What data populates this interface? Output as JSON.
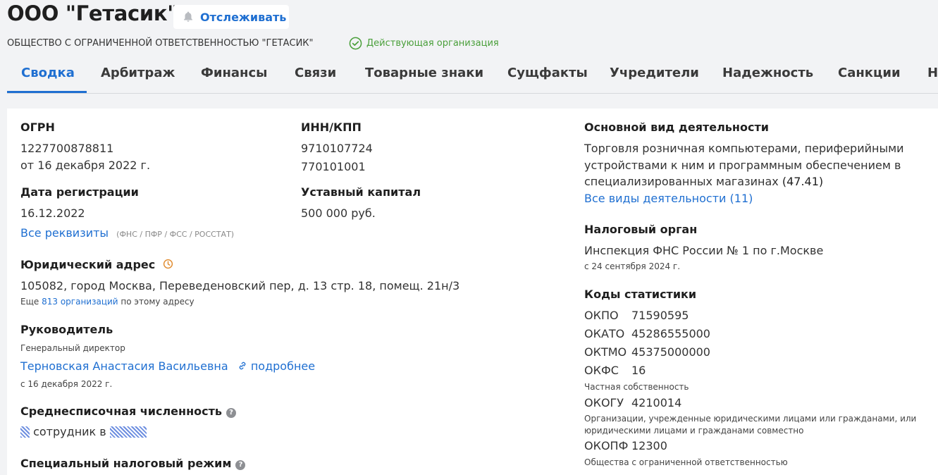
{
  "company": {
    "short_name": "ООО \"Гетасик\"",
    "full_name": "ОБЩЕСТВО С ОГРАНИЧЕННОЙ ОТВЕТСТВЕННОСТЬЮ \"ГЕТАСИК\"",
    "status": "Действующая организация",
    "follow_label": "Отслеживать"
  },
  "tabs": [
    "Сводка",
    "Арбитраж",
    "Финансы",
    "Связи",
    "Товарные знаки",
    "Сущфакты",
    "Учредители",
    "Надежность",
    "Санкции",
    "Н"
  ],
  "ogrn": {
    "label": "ОГРН",
    "value": "1227700878811",
    "date": "от 16 декабря 2022 г."
  },
  "inn": {
    "label": "ИНН/КПП",
    "inn": "9710107724",
    "kpp": "770101001"
  },
  "reg": {
    "label": "Дата регистрации",
    "value": "16.12.2022"
  },
  "capital": {
    "label": "Уставный капитал",
    "value": "500 000 руб."
  },
  "requisites": {
    "link": "Все реквизиты",
    "note": "(ФНС / ПФР / ФСС / РОССТАТ)"
  },
  "address": {
    "label": "Юридический адрес",
    "value": "105082, город Москва, Переведеновский пер, д. 13 стр. 18, помещ. 21н/3",
    "more_prefix": "Еще",
    "more_link": "813 организаций",
    "more_suffix": "по этому адресу"
  },
  "head": {
    "label": "Руководитель",
    "position": "Генеральный директор",
    "name": "Терновская Анастасия Васильевна",
    "more": "подробнее",
    "since": "с 16 декабря 2022 г."
  },
  "employees": {
    "label": "Среднесписочная численность",
    "text": "сотрудник в"
  },
  "tax_regime": {
    "label": "Специальный налоговый режим"
  },
  "activity": {
    "label": "Основной вид деятельности",
    "line1": "Торговля розничная компьютерами, периферийными",
    "line2": "устройствами к ним и программным обеспечением в",
    "line3": "специализированных магазинах",
    "code": "(47.41)",
    "all_link": "Все виды деятельности (11)"
  },
  "tax_office": {
    "label": "Налоговый орган",
    "value": "Инспекция ФНС России № 1 по г.Москве",
    "since": "с 24 сентября 2024 г."
  },
  "stat_codes": {
    "label": "Коды статистики",
    "okpo": {
      "code": "ОКПО",
      "value": "71590595"
    },
    "okato": {
      "code": "ОКАТО",
      "value": "45286555000"
    },
    "oktmo": {
      "code": "ОКТМО",
      "value": "45375000000"
    },
    "okfs": {
      "code": "ОКФС",
      "value": "16",
      "desc": "Частная собственность"
    },
    "okogu": {
      "code": "ОКОГУ",
      "value": "4210014",
      "desc1": "Организации, учрежденные юридическими лицами или гражданами, или",
      "desc2": "юридическими лицами и гражданами совместно"
    },
    "okopf": {
      "code": "ОКОПФ",
      "value": "12300",
      "desc": "Общества с ограниченной ответственностью"
    }
  },
  "colors": {
    "accent": "#1f6fd1",
    "status_green": "#4a9f3a"
  }
}
